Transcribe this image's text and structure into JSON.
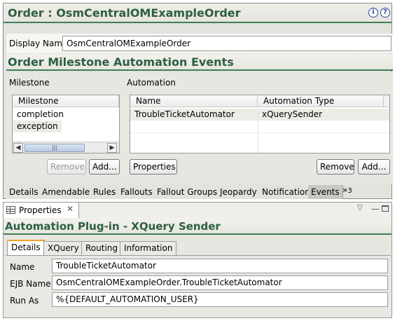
{
  "editor": {
    "title": "Order : OsmCentralOMExampleOrder",
    "display_name_label": "Display Nam",
    "display_name_value": "OsmCentralOMExampleOrder",
    "section_title": "Order Milestone Automation Events",
    "milestone_caption": "Milestone",
    "automation_caption": "Automation",
    "milestone_table": {
      "header": "Milestone",
      "rows": [
        "completion",
        "exception"
      ]
    },
    "automation_table": {
      "headers": [
        "Name",
        "Automation Type"
      ],
      "rows": [
        {
          "name": "TroubleTicketAutomator",
          "type": "xQuerySender"
        }
      ]
    },
    "buttons": {
      "remove_left": "Remove",
      "add_left": "Add...",
      "properties": "Properties",
      "remove_right": "Remove",
      "add_right": "Add..."
    },
    "tabs": [
      "Details",
      "Amendable",
      "Rules",
      "Fallouts",
      "Fallout Groups",
      "Jeopardy",
      "Notification",
      "Events"
    ],
    "active_tab": "Events",
    "overflow_label": "»",
    "overflow_count": "3"
  },
  "properties": {
    "view_title": "Properties",
    "header_title": "Automation Plug-in - XQuery Sender",
    "tabs": [
      "Details",
      "XQuery",
      "Routing",
      "Information"
    ],
    "active_tab": "Details",
    "fields": [
      {
        "label": "Name",
        "value": "TroubleTicketAutomator"
      },
      {
        "label": "EJB Name",
        "value": "OsmCentralOMExampleOrder.TroubleTicketAutomator"
      },
      {
        "label": "Run As",
        "value": "%{DEFAULT_AUTOMATION_USER}"
      }
    ]
  },
  "colors": {
    "accent_green": "#2d5f44",
    "active_tab_orange": "#f0a028"
  }
}
